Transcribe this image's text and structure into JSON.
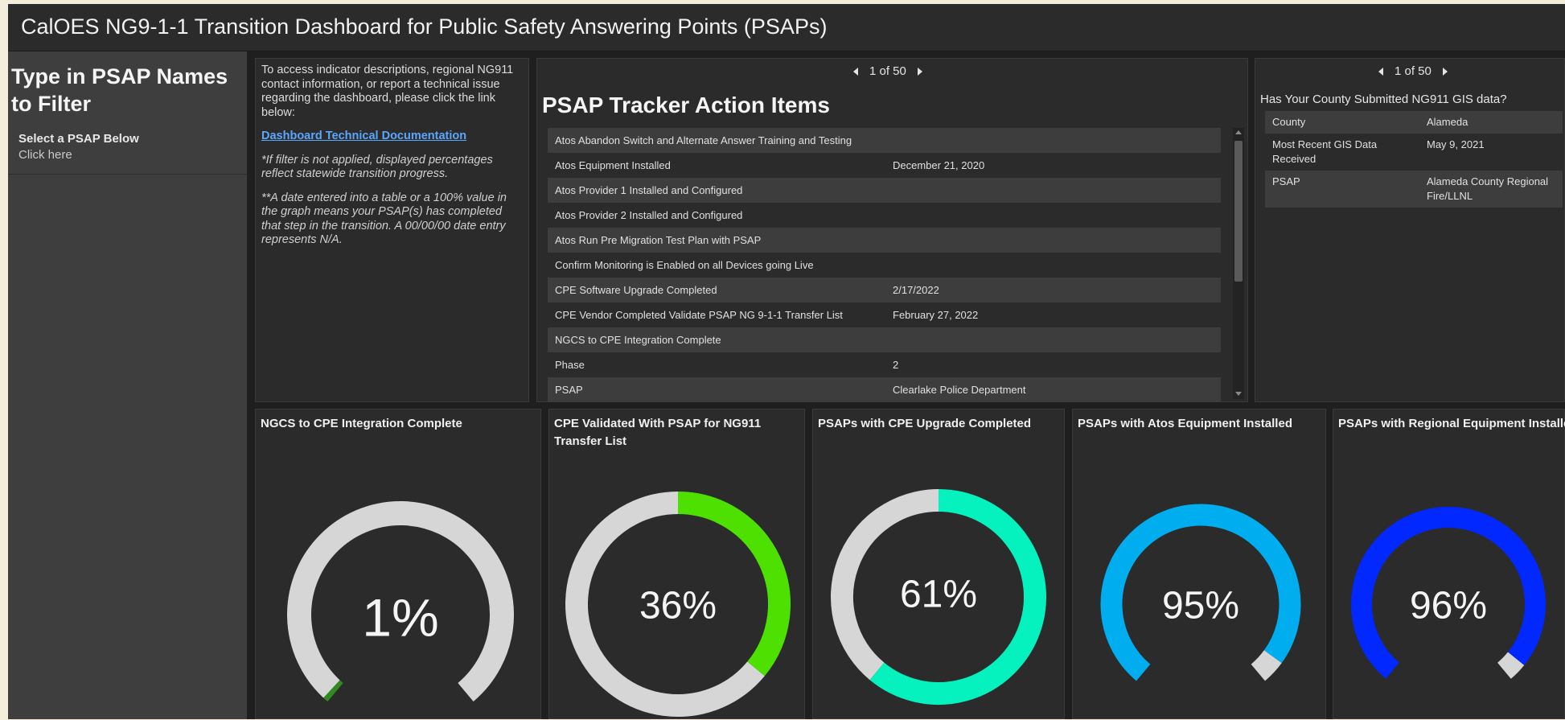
{
  "header": {
    "title": "CalOES NG9-1-1 Transition Dashboard for Public Safety Answering Points (PSAPs)"
  },
  "sidebar": {
    "heading": "Type in PSAP Names to Filter",
    "select_label": "Select a PSAP Below",
    "select_value": "Click here"
  },
  "info": {
    "intro": "To access indicator descriptions, regional NG911 contact information, or report a technical issue regarding the dashboard, please click the link below:",
    "link": "Dashboard Technical Documentation",
    "note1": "*If filter is not applied, displayed percentages reflect statewide transition progress.",
    "note2": "**A date entered into a table or a 100% value in the graph means your PSAP(s) has completed that step in the transition. A 00/00/00 date entry represents N/A."
  },
  "tracker": {
    "pager": "1 of 50",
    "title": "PSAP Tracker Action Items",
    "rows": [
      {
        "label": "Atos Abandon Switch and Alternate Answer Training and Testing",
        "value": ""
      },
      {
        "label": "Atos Equipment Installed",
        "value": "December 21, 2020"
      },
      {
        "label": "Atos Provider 1 Installed and Configured",
        "value": ""
      },
      {
        "label": "Atos Provider 2 Installed and Configured",
        "value": ""
      },
      {
        "label": "Atos Run Pre Migration Test Plan with PSAP",
        "value": ""
      },
      {
        "label": "Confirm Monitoring is Enabled on all Devices going Live",
        "value": ""
      },
      {
        "label": "CPE Software Upgrade Completed",
        "value": "2/17/2022"
      },
      {
        "label": "CPE Vendor Completed Validate PSAP NG 9-1-1 Transfer List",
        "value": "February 27, 2022"
      },
      {
        "label": "NGCS to CPE Integration Complete",
        "value": ""
      },
      {
        "label": "Phase",
        "value": "2"
      },
      {
        "label": "PSAP",
        "value": "Clearlake Police Department"
      }
    ]
  },
  "gis": {
    "pager": "1 of 50",
    "question": "Has Your County Submitted NG911 GIS data?",
    "rows": [
      {
        "label": "County",
        "value": "Alameda"
      },
      {
        "label": "Most Recent GIS Data Received",
        "value": "May 9, 2021"
      },
      {
        "label": "PSAP",
        "value": "Alameda County Regional Fire/LLNL"
      }
    ]
  },
  "gauges": [
    {
      "title": "NGCS to CPE Integration Complete",
      "percent": 1,
      "label": "1%",
      "color": "#2f8a1f",
      "type": "gauge"
    },
    {
      "title": "CPE Validated With PSAP for NG911 Transfer List",
      "percent": 36,
      "label": "36%",
      "color": "#4ee000",
      "type": "ring"
    },
    {
      "title": "PSAPs with CPE Upgrade Completed",
      "percent": 61,
      "label": "61%",
      "color": "#05f2bf",
      "type": "ring"
    },
    {
      "title": "PSAPs with Atos Equipment Installed",
      "percent": 95,
      "label": "95%",
      "color": "#00aeef",
      "type": "gauge"
    },
    {
      "title": "PSAPs with Regional Equipment Installed",
      "percent": 96,
      "label": "96%",
      "color": "#0028ff",
      "type": "gauge"
    }
  ],
  "colors": {
    "track": "#d6d6d6",
    "panel": "#2b2b2b",
    "link": "#5aa7ff"
  }
}
